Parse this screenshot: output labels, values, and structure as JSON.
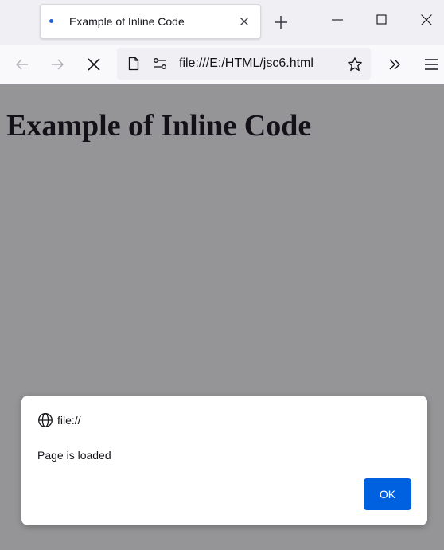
{
  "tab": {
    "title": "Example of Inline Code",
    "favicon": "loading-dot-icon"
  },
  "toolbar": {
    "back_icon": "back-arrow-icon",
    "forward_icon": "forward-arrow-icon",
    "stop_icon": "stop-loading-icon",
    "url": "file:///E:/HTML/jsc6.html",
    "page_icon": "page-icon",
    "permissions_icon": "site-permissions-icon",
    "bookmark_icon": "star-icon",
    "overflow_icon": "chevron-overflow-icon",
    "menu_icon": "hamburger-menu-icon"
  },
  "window_controls": [
    "minimize-icon",
    "maximize-icon",
    "close-window-icon"
  ],
  "page": {
    "heading": "Example of Inline Code"
  },
  "dialog": {
    "origin": "file://",
    "origin_icon": "globe-icon",
    "message": "Page is loaded",
    "ok_label": "OK"
  },
  "colors": {
    "accent": "#0061e0",
    "overlay": "#959597",
    "heading": "#141018"
  }
}
